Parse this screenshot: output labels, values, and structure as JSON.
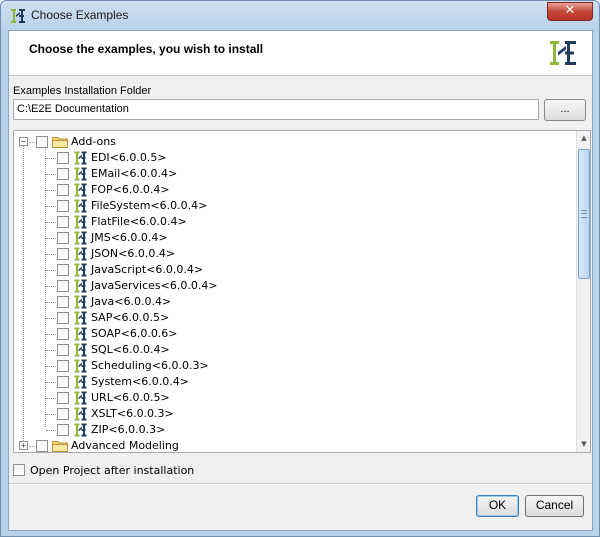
{
  "window": {
    "title": "Choose Examples",
    "close_label": "✕"
  },
  "header": {
    "heading": "Choose the examples, you wish to install"
  },
  "folder": {
    "label": "Examples Installation Folder",
    "value": "C:\\E2E Documentation",
    "browse_label": "..."
  },
  "tree": {
    "root": {
      "label": "Add-ons",
      "expander": "−"
    },
    "items": [
      {
        "label": "EDI<6.0.0.5>"
      },
      {
        "label": "EMail<6.0.0.4>"
      },
      {
        "label": "FOP<6.0.0.4>"
      },
      {
        "label": "FileSystem<6.0.0.4>"
      },
      {
        "label": "FlatFile<6.0.0.4>"
      },
      {
        "label": "JMS<6.0.0.4>"
      },
      {
        "label": "JSON<6.0.0.4>"
      },
      {
        "label": "JavaScript<6.0.0.4>"
      },
      {
        "label": "JavaServices<6.0.0.4>"
      },
      {
        "label": "Java<6.0.0.4>"
      },
      {
        "label": "SAP<6.0.0.5>"
      },
      {
        "label": "SOAP<6.0.0.6>"
      },
      {
        "label": "SQL<6.0.0.4>"
      },
      {
        "label": "Scheduling<6.0.0.3>"
      },
      {
        "label": "System<6.0.0.4>"
      },
      {
        "label": "URL<6.0.0.5>"
      },
      {
        "label": "XSLT<6.0.0.3>"
      },
      {
        "label": "ZIP<6.0.0.3>"
      }
    ],
    "next_root": {
      "label": "Advanced Modeling",
      "expander": "+"
    },
    "scroll": {
      "up": "▲",
      "down": "▼"
    }
  },
  "options": {
    "open_project_label": "Open Project after installation"
  },
  "buttons": {
    "ok_label": "OK",
    "cancel_label": "Cancel"
  },
  "colors": {
    "logo_green": "#8db83a",
    "logo_navy": "#1f3b5f"
  },
  "icons": {
    "root": "folder-icon",
    "item": "e2e-icon",
    "app": "e2e-logo-icon"
  }
}
